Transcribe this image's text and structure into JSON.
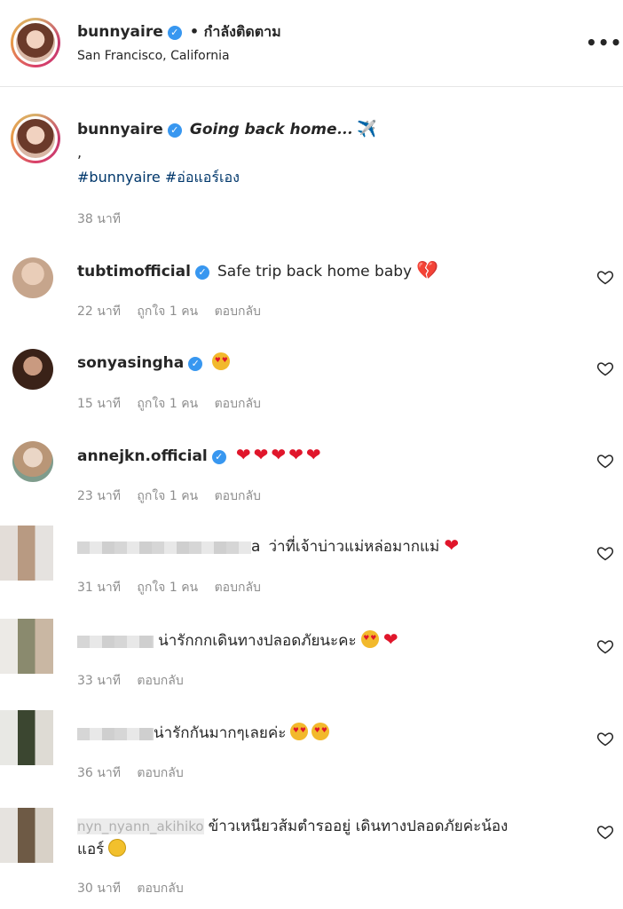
{
  "post_header": {
    "username": "bunnyaire",
    "follow_status": "• กำลังติดตาม",
    "location": "San Francisco, California",
    "more_icon": "more-options-icon"
  },
  "caption": {
    "username": "bunnyaire",
    "text": "𝙂𝙤𝙞𝙣𝙜 𝙗𝙖𝙘𝙠 𝙝𝙤𝙢𝙚...",
    "emoji": "✈️",
    "dot": ",",
    "hashtags": "#bunnyaire #อ่อแอร์เอง",
    "time": "38 นาที"
  },
  "comments": [
    {
      "username": "tubtimofficial",
      "text": "Safe trip back home baby",
      "emoji": "💔",
      "time": "22 นาที",
      "likes": "ถูกใจ 1 คน",
      "reply": "ตอบกลับ"
    },
    {
      "username": "sonyasingha",
      "text": "",
      "emoji": "😍",
      "time": "15 นาที",
      "likes": "ถูกใจ 1 คน",
      "reply": "ตอบกลับ"
    },
    {
      "username": "annejkn.official",
      "text": "",
      "emoji": "❤❤❤❤❤",
      "time": "23 นาที",
      "likes": "ถูกใจ 1 คน",
      "reply": "ตอบกลับ"
    },
    {
      "username_suffix": "a",
      "text": "ว่าที่เจ้าบ่าวแม่หล่อมากแม่",
      "emoji": "❤",
      "time": "31 นาที",
      "likes": "ถูกใจ 1 คน",
      "reply": "ตอบกลับ"
    },
    {
      "username_suffix": "",
      "text": "น่ารักกกเดินทางปลอดภัยนะคะ",
      "emoji": "😍 ❤",
      "time": "33 นาที",
      "reply": "ตอบกลับ"
    },
    {
      "username_suffix": "",
      "text": "น่ารักกันมากๆเลยค่ะ",
      "emoji": "😍😍",
      "time": "36 นาที",
      "reply": "ตอบกลับ"
    },
    {
      "username_partial": "nyn_nyann_akihiko",
      "text": "ข้าวเหนียวส้มตำรออยู่ เดินทางปลอดภัยค่ะน้อง",
      "text_line2": "แอร์",
      "emoji": "😊",
      "time": "30 นาที",
      "reply": "ตอบกลับ"
    }
  ],
  "colors": {
    "verified": "#3897f0",
    "hashtag": "#00376b",
    "heart_red": "#e0162b",
    "muted": "#8e8e8e"
  }
}
